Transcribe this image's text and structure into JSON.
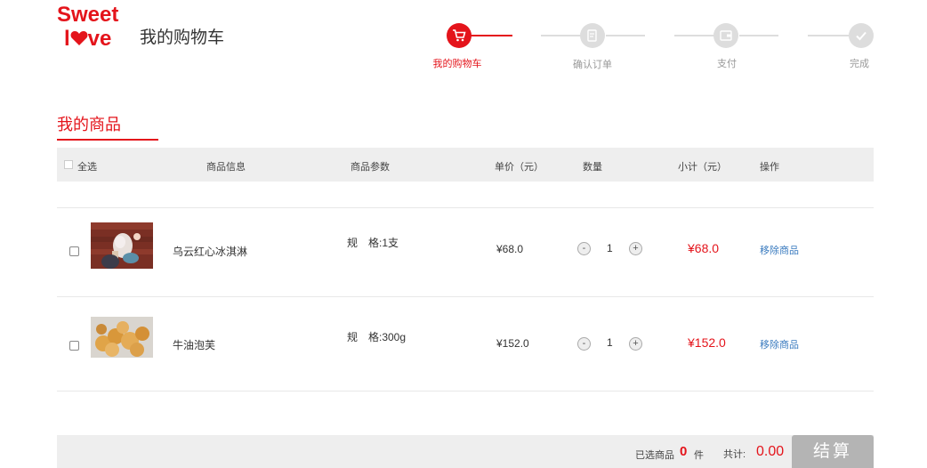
{
  "logo": {
    "line1": "Sweet",
    "line2_a": "l",
    "line2_b": "ve"
  },
  "page_title": "我的购物车",
  "steps": [
    {
      "label": "我的购物车",
      "icon": "cart-icon",
      "active": true
    },
    {
      "label": "确认订单",
      "icon": "order-icon",
      "active": false
    },
    {
      "label": "支付",
      "icon": "wallet-icon",
      "active": false
    },
    {
      "label": "完成",
      "icon": "check-icon",
      "active": false
    }
  ],
  "section_title": "我的商品",
  "table_header": {
    "select_all": "全选",
    "info": "商品信息",
    "params": "商品参数",
    "unit_price": "单价（元）",
    "quantity": "数量",
    "subtotal": "小计（元）",
    "action": "操作"
  },
  "items": [
    {
      "name": "乌云红心冰淇淋",
      "param": "规　格:1支",
      "price": "¥68.0",
      "minus": "-",
      "qty": "1",
      "plus": "+",
      "subtotal": "¥68.0",
      "remove": "移除商品"
    },
    {
      "name": "牛油泡芙",
      "param": "规　格:300g",
      "price": "¥152.0",
      "minus": "-",
      "qty": "1",
      "plus": "+",
      "subtotal": "¥152.0",
      "remove": "移除商品"
    }
  ],
  "footer": {
    "selected_label": "已选商品",
    "selected_count": "0",
    "unit": "件",
    "total_label": "共计:",
    "total": "0.00",
    "checkout": "结算"
  },
  "colors": {
    "accent": "#e4141b",
    "link": "#3a7bbf",
    "gray_bg": "#eeeeee"
  }
}
